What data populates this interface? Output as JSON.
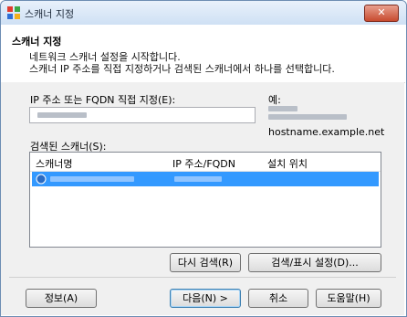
{
  "window": {
    "title": "스캐너 지정",
    "close_label": "✕"
  },
  "header": {
    "title": "스캐너 지정",
    "desc_line1": "네트워크 스캐너 설정을 시작합니다.",
    "desc_line2": "스캐너 IP 주소를 직접 지정하거나 검색된 스캐너에서 하나를 선택합니다."
  },
  "ip_field": {
    "label": "IP 주소 또는 FQDN 직접 지정(E):"
  },
  "example": {
    "label": "예:",
    "hostname": "hostname.example.net"
  },
  "scanners": {
    "label": "검색된 스캐너(S):",
    "columns": [
      "스캐너명",
      "IP 주소/FQDN",
      "설치 위치"
    ]
  },
  "buttons": {
    "search_again": "다시 검색(R)",
    "search_settings": "검색/표시 설정(D)...",
    "info": "정보(A)",
    "next": "다음(N) >",
    "cancel": "취소",
    "help": "도움말(H)"
  },
  "colors": {
    "selection": "#3399ff",
    "titlebar": "#cfe0f4"
  }
}
